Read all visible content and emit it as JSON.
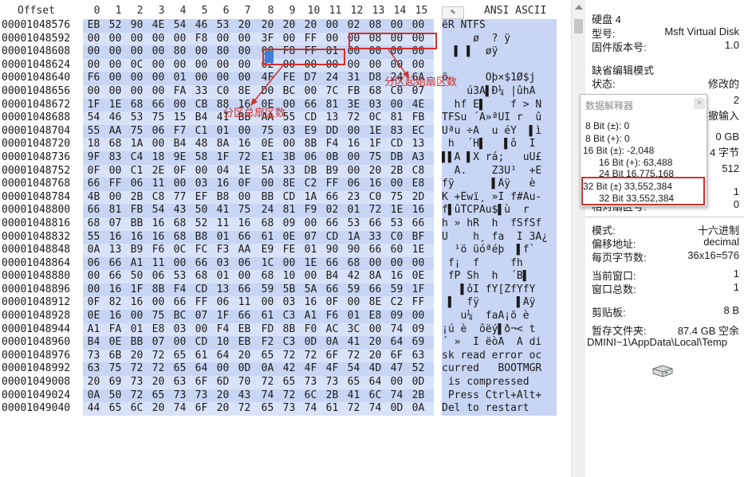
{
  "hex": {
    "offset_header": "Offset",
    "col_headers": [
      "0",
      "1",
      "2",
      "3",
      "4",
      "5",
      "6",
      "7",
      "8",
      "9",
      "10",
      "11",
      "12",
      "13",
      "14",
      "15"
    ],
    "rows": [
      {
        "off": "00001048576",
        "b": [
          "EB",
          "52",
          "90",
          "4E",
          "54",
          "46",
          "53",
          "20",
          "20",
          "20",
          "20",
          "00",
          "02",
          "08",
          "00",
          "00"
        ],
        "t": "ëR NTFS"
      },
      {
        "off": "00001048592",
        "b": [
          "00",
          "00",
          "00",
          "00",
          "00",
          "F8",
          "00",
          "00",
          "3F",
          "00",
          "FF",
          "00",
          "00",
          "08",
          "00",
          "00"
        ],
        "t": "     ø  ? ÿ"
      },
      {
        "off": "00001048608",
        "b": [
          "00",
          "00",
          "00",
          "00",
          "80",
          "00",
          "80",
          "00",
          "00",
          "F8",
          "FF",
          "01",
          "00",
          "00",
          "00",
          "00"
        ],
        "t": "  ▌ ▌  øÿ"
      },
      {
        "off": "00001048624",
        "b": [
          "00",
          "00",
          "0C",
          "00",
          "00",
          "00",
          "00",
          "00",
          "02",
          "00",
          "00",
          "00",
          "00",
          "00",
          "00",
          "00"
        ],
        "t": ""
      },
      {
        "off": "00001048640",
        "b": [
          "F6",
          "00",
          "00",
          "00",
          "01",
          "00",
          "00",
          "00",
          "4F",
          "FE",
          "D7",
          "24",
          "31",
          "D8",
          "24",
          "6A"
        ],
        "t": "ö      Oþ×$1Ø$j"
      },
      {
        "off": "00001048656",
        "b": [
          "00",
          "00",
          "00",
          "00",
          "FA",
          "33",
          "C0",
          "8E",
          "D0",
          "BC",
          "00",
          "7C",
          "FB",
          "68",
          "C0",
          "07"
        ],
        "t": "    ú3À▌Ð¼ |ûhÀ"
      },
      {
        "off": "00001048672",
        "b": [
          "1F",
          "1E",
          "68",
          "66",
          "00",
          "CB",
          "88",
          "16",
          "0E",
          "00",
          "66",
          "81",
          "3E",
          "03",
          "00",
          "4E"
        ],
        "t": "  hf Ë▌    f > N"
      },
      {
        "off": "00001048688",
        "b": [
          "54",
          "46",
          "53",
          "75",
          "15",
          "B4",
          "41",
          "BB",
          "AA",
          "55",
          "CD",
          "13",
          "72",
          "0C",
          "81",
          "FB"
        ],
        "t": "TFSu ´A»ªUÍ r  û"
      },
      {
        "off": "00001048704",
        "b": [
          "55",
          "AA",
          "75",
          "06",
          "F7",
          "C1",
          "01",
          "00",
          "75",
          "03",
          "E9",
          "DD",
          "00",
          "1E",
          "83",
          "EC"
        ],
        "t": "Uªu ÷Á  u éÝ  ▌ì"
      },
      {
        "off": "00001048720",
        "b": [
          "18",
          "68",
          "1A",
          "00",
          "B4",
          "48",
          "8A",
          "16",
          "0E",
          "00",
          "8B",
          "F4",
          "16",
          "1F",
          "CD",
          "13"
        ],
        "t": " h  ´H▌   ▌ô  Í"
      },
      {
        "off": "00001048736",
        "b": [
          "9F",
          "83",
          "C4",
          "18",
          "9E",
          "58",
          "1F",
          "72",
          "E1",
          "3B",
          "06",
          "0B",
          "00",
          "75",
          "DB",
          "A3"
        ],
        "t": "▌▌Ä ▌X rá;   uÛ£"
      },
      {
        "off": "00001048752",
        "b": [
          "0F",
          "00",
          "C1",
          "2E",
          "0F",
          "00",
          "04",
          "1E",
          "5A",
          "33",
          "DB",
          "B9",
          "00",
          "20",
          "2B",
          "C8"
        ],
        "t": "  Á.    Z3Û¹  +È"
      },
      {
        "off": "00001048768",
        "b": [
          "66",
          "FF",
          "06",
          "11",
          "00",
          "03",
          "16",
          "0F",
          "00",
          "8E",
          "C2",
          "FF",
          "06",
          "16",
          "00",
          "E8"
        ],
        "t": "fÿ      ▌Âÿ   è"
      },
      {
        "off": "00001048784",
        "b": [
          "4B",
          "00",
          "2B",
          "C8",
          "77",
          "EF",
          "B8",
          "00",
          "BB",
          "CD",
          "1A",
          "66",
          "23",
          "C0",
          "75",
          "2D"
        ],
        "t": "K +Èwï¸ »Í f#Àu-"
      },
      {
        "off": "00001048800",
        "b": [
          "66",
          "81",
          "FB",
          "54",
          "43",
          "50",
          "41",
          "75",
          "24",
          "81",
          "F9",
          "02",
          "01",
          "72",
          "1E",
          "16"
        ],
        "t": "f▌ûTCPAu$▌ù  r"
      },
      {
        "off": "00001048816",
        "b": [
          "68",
          "07",
          "BB",
          "16",
          "68",
          "52",
          "11",
          "16",
          "68",
          "09",
          "00",
          "66",
          "53",
          "66",
          "53",
          "66"
        ],
        "t": "h » hR  h  fSfSf"
      },
      {
        "off": "00001048832",
        "b": [
          "55",
          "16",
          "16",
          "16",
          "68",
          "B8",
          "01",
          "66",
          "61",
          "0E",
          "07",
          "CD",
          "1A",
          "33",
          "C0",
          "BF"
        ],
        "t": "U    h¸ fa  Í 3À¿"
      },
      {
        "off": "00001048848",
        "b": [
          "0A",
          "13",
          "B9",
          "F6",
          "0C",
          "FC",
          "F3",
          "AA",
          "E9",
          "FE",
          "01",
          "90",
          "90",
          "66",
          "60",
          "1E"
        ],
        "t": "  ¹ö üóªéþ  ▌f`"
      },
      {
        "off": "00001048864",
        "b": [
          "06",
          "66",
          "A1",
          "11",
          "00",
          "66",
          "03",
          "06",
          "1C",
          "00",
          "1E",
          "66",
          "68",
          "00",
          "00",
          "00"
        ],
        "t": " f¡  f     fh"
      },
      {
        "off": "00001048880",
        "b": [
          "00",
          "66",
          "50",
          "06",
          "53",
          "68",
          "01",
          "00",
          "68",
          "10",
          "00",
          "B4",
          "42",
          "8A",
          "16",
          "0E"
        ],
        "t": " fP Sh  h  ´B▌"
      },
      {
        "off": "00001048896",
        "b": [
          "00",
          "16",
          "1F",
          "8B",
          "F4",
          "CD",
          "13",
          "66",
          "59",
          "5B",
          "5A",
          "66",
          "59",
          "66",
          "59",
          "1F"
        ],
        "t": "   ▌ôÍ fY[ZfYfY"
      },
      {
        "off": "00001048912",
        "b": [
          "0F",
          "82",
          "16",
          "00",
          "66",
          "FF",
          "06",
          "11",
          "00",
          "03",
          "16",
          "0F",
          "00",
          "8E",
          "C2",
          "FF"
        ],
        "t": " ▌  fÿ      ▌Âÿ"
      },
      {
        "off": "00001048928",
        "b": [
          "0E",
          "16",
          "00",
          "75",
          "BC",
          "07",
          "1F",
          "66",
          "61",
          "C3",
          "A1",
          "F6",
          "01",
          "E8",
          "09",
          "00"
        ],
        "t": "   u¼  faÃ¡ö è"
      },
      {
        "off": "00001048944",
        "b": [
          "A1",
          "FA",
          "01",
          "E8",
          "03",
          "00",
          "F4",
          "EB",
          "FD",
          "8B",
          "F0",
          "AC",
          "3C",
          "00",
          "74",
          "09"
        ],
        "t": "¡ú è  ôëý▌ð¬< t"
      },
      {
        "off": "00001048960",
        "b": [
          "B4",
          "0E",
          "BB",
          "07",
          "00",
          "CD",
          "10",
          "EB",
          "F2",
          "C3",
          "0D",
          "0A",
          "41",
          "20",
          "64",
          "69"
        ],
        "t": "´ »  Í ëòÃ  A di"
      },
      {
        "off": "00001048976",
        "b": [
          "73",
          "6B",
          "20",
          "72",
          "65",
          "61",
          "64",
          "20",
          "65",
          "72",
          "72",
          "6F",
          "72",
          "20",
          "6F",
          "63"
        ],
        "t": "sk read error oc"
      },
      {
        "off": "00001048992",
        "b": [
          "63",
          "75",
          "72",
          "72",
          "65",
          "64",
          "00",
          "0D",
          "0A",
          "42",
          "4F",
          "4F",
          "54",
          "4D",
          "47",
          "52"
        ],
        "t": "curred   BOOTMGR"
      },
      {
        "off": "00001049008",
        "b": [
          "20",
          "69",
          "73",
          "20",
          "63",
          "6F",
          "6D",
          "70",
          "72",
          "65",
          "73",
          "73",
          "65",
          "64",
          "00",
          "0D"
        ],
        "t": " is compressed"
      },
      {
        "off": "00001049024",
        "b": [
          "0A",
          "50",
          "72",
          "65",
          "73",
          "73",
          "20",
          "43",
          "74",
          "72",
          "6C",
          "2B",
          "41",
          "6C",
          "74",
          "2B"
        ],
        "t": " Press Ctrl+Alt+"
      },
      {
        "off": "00001049040",
        "b": [
          "44",
          "65",
          "6C",
          "20",
          "74",
          "6F",
          "20",
          "72",
          "65",
          "73",
          "74",
          "61",
          "72",
          "74",
          "0D",
          "0A"
        ],
        "t": "Del to restart"
      }
    ],
    "text_header": "ANSI ASCII",
    "text_header_icon": "pencil-icon"
  },
  "annotations": {
    "start_sector": "分区起始扇区数",
    "total_sectors": "分区总扇区数",
    "color": "#d0312d"
  },
  "side": {
    "disk_title": "硬盘 4",
    "model_label": "型号:",
    "model_value": "Msft Virtual Disk",
    "firmware_label": "固件版本号:",
    "firmware_value": "1.0",
    "edit_mode_title": "缺省编辑模式",
    "state_label": "状态:",
    "state_value": "修改的",
    "partial_1_value": "2",
    "partial_2_value": "撤输入",
    "partial_3_value": "0 GB",
    "partial_4_value": "4 字节",
    "partial_5_value": "512",
    "partial_6_value": "1",
    "partial_7_label": "相对扇区号:",
    "partial_7_value": "0",
    "mode_label": "模式:",
    "mode_value": "十六进制",
    "offset_label": "偏移地址:",
    "offset_value": "decimal",
    "bpp_label": "每页字节数:",
    "bpp_value": "36x16=576",
    "curwin_label": "当前窗口:",
    "curwin_value": "1",
    "wincount_label": "窗口总数:",
    "wincount_value": "1",
    "clip_label": "剪贴板:",
    "clip_value": "8 B",
    "temp_label": "暂存文件夹:",
    "temp_value": "87.4 GB 空余",
    "temp_path": "DMINI~1\\AppData\\Local\\Temp",
    "disk_icon": "hard-disk-icon"
  },
  "interpreter": {
    "title": "数据解释器",
    "lines": [
      "8 Bit (±): 0",
      "8 Bit (+): 0",
      "16 Bit (±): -2,048",
      "16 Bit (+): 63,488",
      "24 Bit 16,775,168",
      "32 Bit (±) 33,552,384",
      "32 Bit 33,552,384"
    ],
    "close_icon": "close-icon"
  },
  "colors": {
    "hex_band": "#c8d6f4",
    "selection": "#3f7dd7",
    "annotation": "#d0312d"
  }
}
